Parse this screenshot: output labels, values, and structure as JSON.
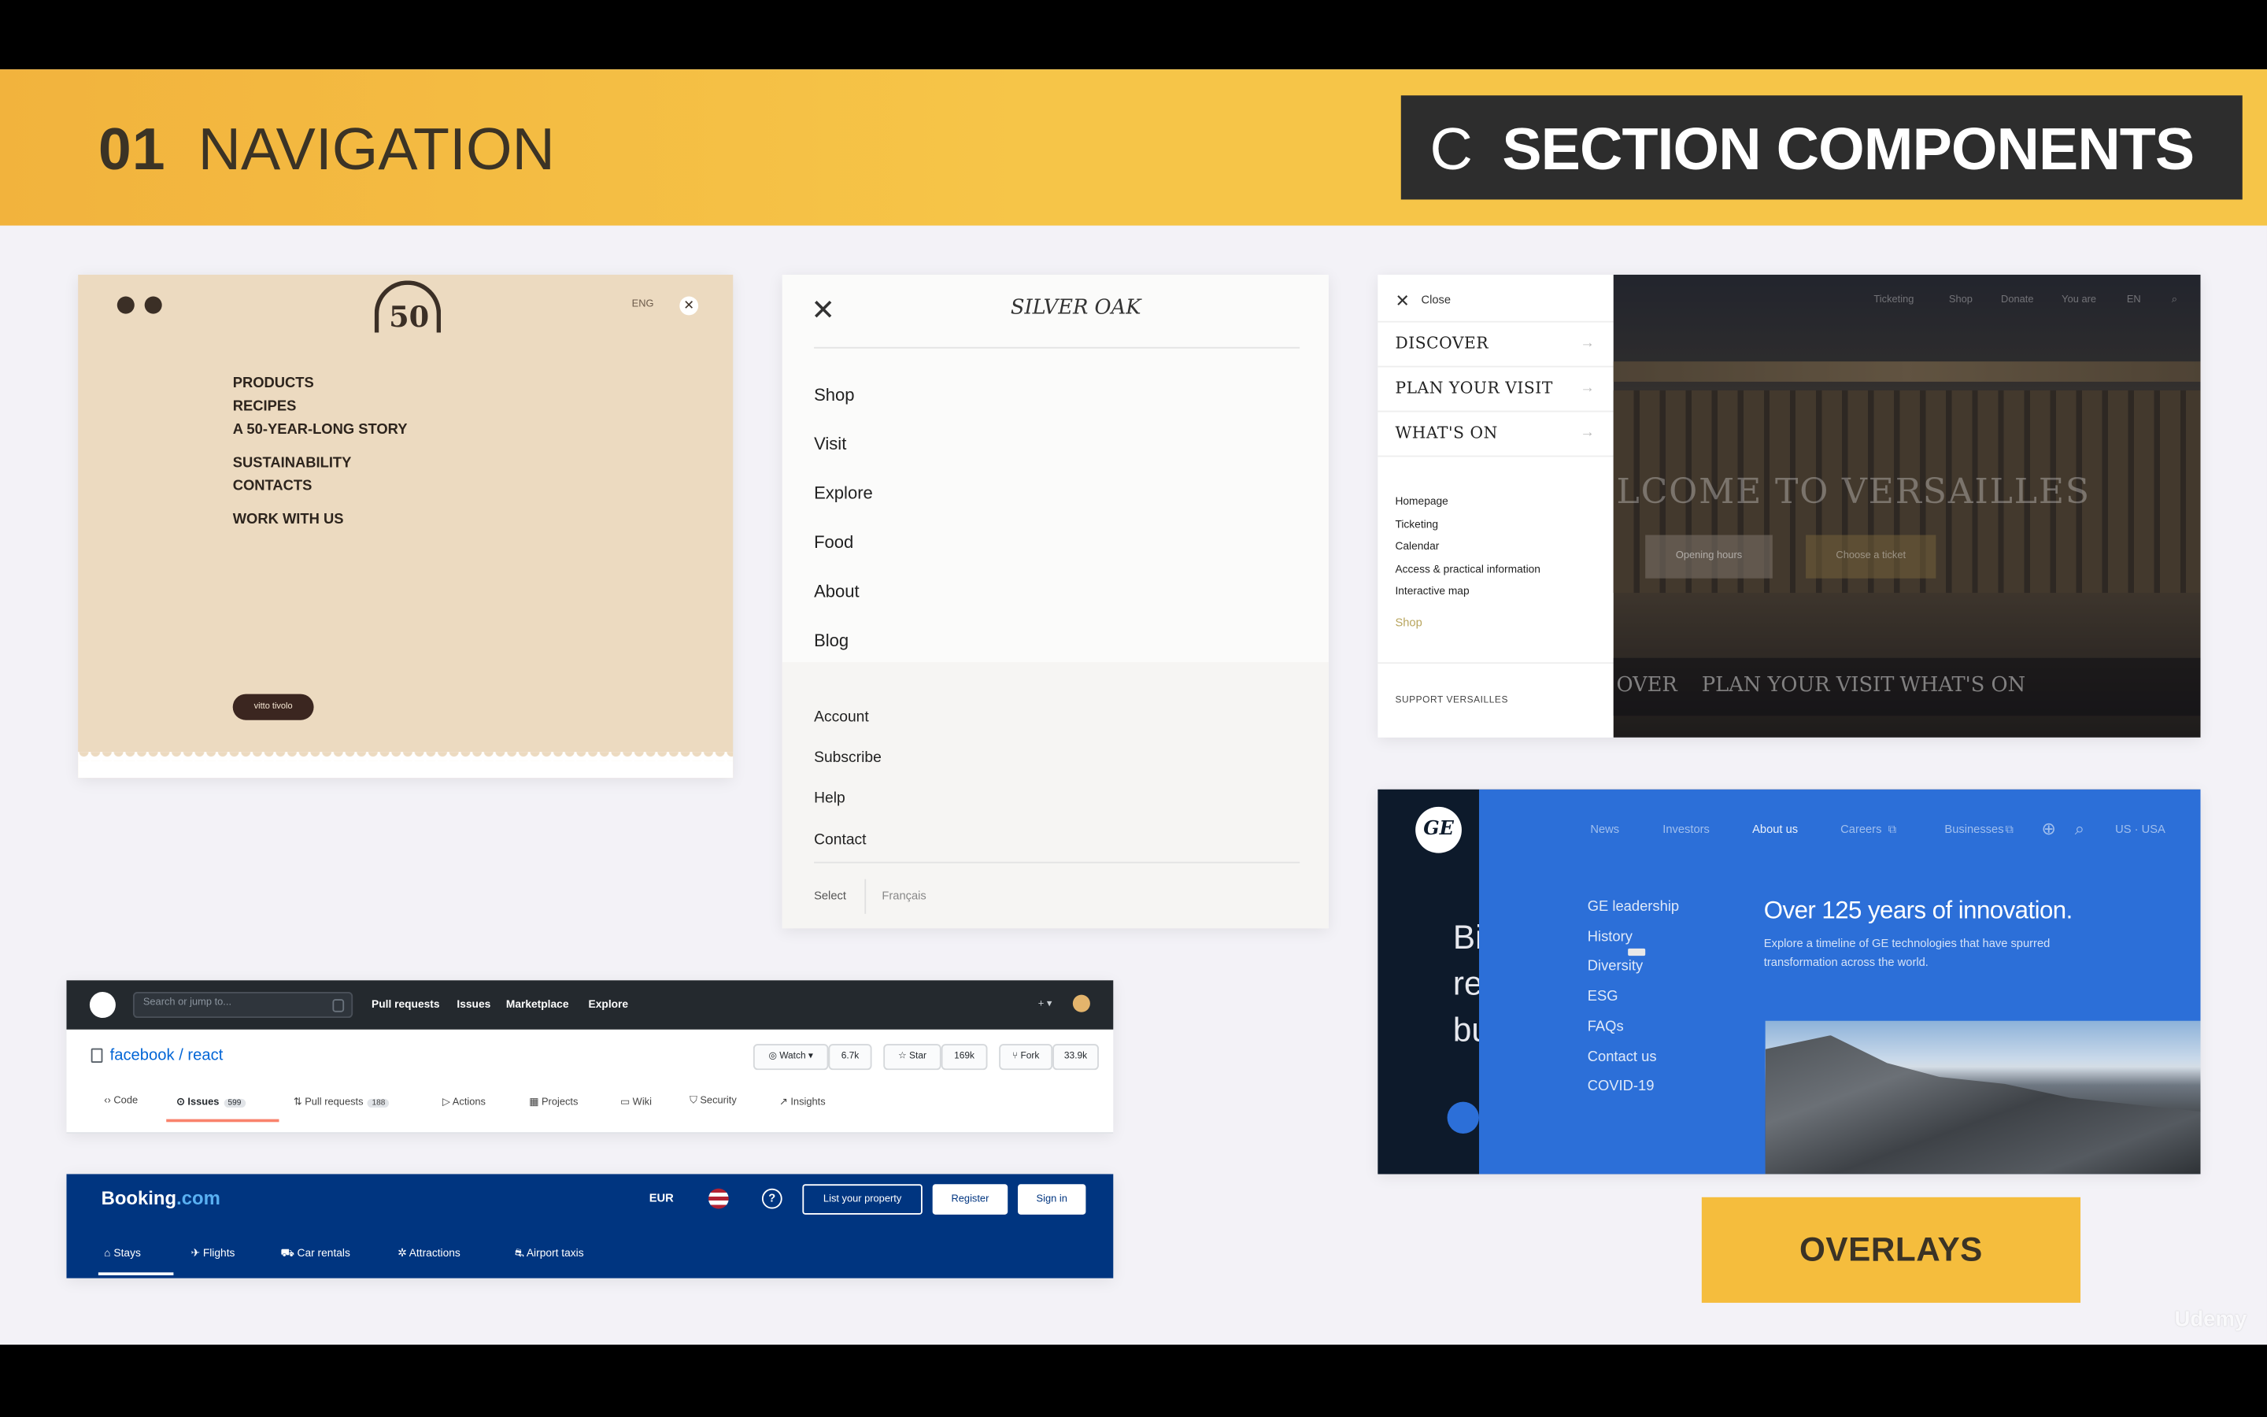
{
  "banner": {
    "number": "01",
    "title": "NAVIGATION",
    "section_letter": "C",
    "section_title": "SECTION COMPONENTS",
    "accent_color": "#f6c548"
  },
  "card_pasta": {
    "logo_number": "50",
    "lang": "ENG",
    "close_icon": "close-icon",
    "menu": [
      "PRODUCTS",
      "RECIPES",
      "A 50-YEAR-LONG STORY",
      "SUSTAINABILITY",
      "CONTACTS",
      "WORK WITH US"
    ],
    "cta": "vitto tivolo"
  },
  "card_silver_oak": {
    "brand": "SILVER OAK",
    "primary_nav": [
      "Shop",
      "Visit",
      "Explore",
      "Food",
      "About",
      "Blog"
    ],
    "secondary_nav": [
      "Account",
      "Subscribe",
      "Help",
      "Contact"
    ],
    "footer_left": "Select",
    "footer_right": "Français"
  },
  "card_versailles": {
    "close_label": "Close",
    "main_menu": [
      "DISCOVER",
      "PLAN YOUR VISIT",
      "WHAT'S ON"
    ],
    "sub_menu": [
      "Homepage",
      "Ticketing",
      "Calendar",
      "Access & practical information",
      "Interactive map"
    ],
    "shop": "Shop",
    "support": "SUPPORT VERSAILLES",
    "top_nav": [
      "Ticketing",
      "Shop",
      "Donate",
      "You are",
      "EN"
    ],
    "headline": "LCOME TO VERSAILLES",
    "button_1": "Opening hours",
    "button_2": "Choose a ticket",
    "bottom_nav": [
      "OVER",
      "PLAN YOUR VISIT",
      "WHAT'S ON"
    ]
  },
  "card_ge": {
    "logo": "GE",
    "dark_text": [
      "Bi",
      "re",
      "bu"
    ],
    "top_nav": [
      "News",
      "Investors",
      "About us",
      "Careers",
      "Businesses"
    ],
    "lang": "US · USA",
    "sub_links": [
      "GE leadership",
      "History",
      "Diversity",
      "ESG",
      "FAQs",
      "Contact us",
      "COVID-19"
    ],
    "heading": "Over 125 years of innovation.",
    "description": "Explore a timeline of GE technologies that have spurred transformation across the world."
  },
  "card_github": {
    "search_placeholder": "Search or jump to...",
    "search_key": "/",
    "top_links": [
      "Pull requests",
      "Issues",
      "Marketplace",
      "Explore"
    ],
    "repo": "facebook / react",
    "watch": "Watch",
    "watch_count": "6.7k",
    "star": "Star",
    "star_count": "169k",
    "fork": "Fork",
    "fork_count": "33.9k",
    "tabs": [
      {
        "label": "Code",
        "count": ""
      },
      {
        "label": "Issues",
        "count": "599"
      },
      {
        "label": "Pull requests",
        "count": "188"
      },
      {
        "label": "Actions",
        "count": ""
      },
      {
        "label": "Projects",
        "count": ""
      },
      {
        "label": "Wiki",
        "count": ""
      },
      {
        "label": "Security",
        "count": ""
      },
      {
        "label": "Insights",
        "count": ""
      }
    ]
  },
  "card_booking": {
    "brand_main": "Booking",
    "brand_suffix": ".com",
    "currency": "EUR",
    "help": "?",
    "list_property": "List your property",
    "register": "Register",
    "sign_in": "Sign in",
    "nav": [
      "Stays",
      "Flights",
      "Car rentals",
      "Attractions",
      "Airport taxis"
    ]
  },
  "overlays_label": "OVERLAYS",
  "watermark": "Udemy"
}
